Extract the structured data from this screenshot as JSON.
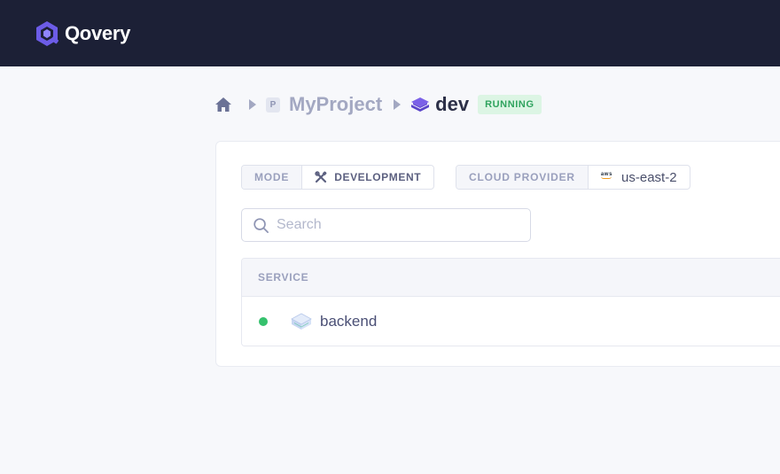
{
  "app": {
    "brand": "Qovery"
  },
  "breadcrumb": {
    "project_badge": "P",
    "project": "MyProject",
    "environment": "dev",
    "status": "RUNNING"
  },
  "environment_info": {
    "mode_label": "MODE",
    "mode_value": "DEVELOPMENT",
    "provider_label": "CLOUD PROVIDER",
    "provider_logo": "aws",
    "region": "us-east-2"
  },
  "search": {
    "placeholder": "Search",
    "value": ""
  },
  "table": {
    "header": "SERVICE",
    "rows": [
      {
        "name": "backend",
        "status_color": "#35c16d"
      }
    ]
  },
  "colors": {
    "topbar": "#1c2036",
    "brand_accent": "#6c5ce7",
    "running_bg": "#dcf5e4",
    "running_text": "#2fa35e",
    "status_dot": "#35c16d"
  },
  "icons": {
    "logo": "qovery-logo-icon",
    "home": "home-icon",
    "separator": "chevron-right-icon",
    "environment": "layers-icon",
    "mode": "tools-icon",
    "provider": "aws-icon",
    "search": "search-icon",
    "service": "service-cube-icon"
  }
}
